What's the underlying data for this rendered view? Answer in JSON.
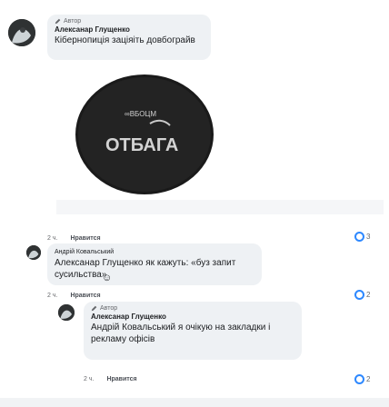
{
  "statusbar": {
    "text": ""
  },
  "post": {
    "badge": "Автор",
    "author": "Алексанар Глущенко",
    "text": "Кібернопиція заціяіть довбограйв",
    "media_caption_lines": [
      "∞ВБОЦМ",
      "ОТБАГА"
    ]
  },
  "comments": [
    {
      "time": "2 ч.",
      "like": "Нравится",
      "reactions": "3"
    },
    {
      "author": "Андрій Ковальський",
      "text": "Алексанар Глущенко як кажуть: «буз запит сусильства»",
      "time": "2 ч.",
      "like": "Нравится",
      "reactions": "2"
    },
    {
      "badge": "Автор",
      "author": "Алексанар Глущенко",
      "text": "Андрій Ковальський я очікую на закладки і рекламу офісів",
      "time": "2 ч.",
      "like": "Нравится",
      "reactions": "2"
    }
  ],
  "colors": {
    "accent": "#2d88ff",
    "bubble": "#eef1f4",
    "muted": "#65676b"
  }
}
